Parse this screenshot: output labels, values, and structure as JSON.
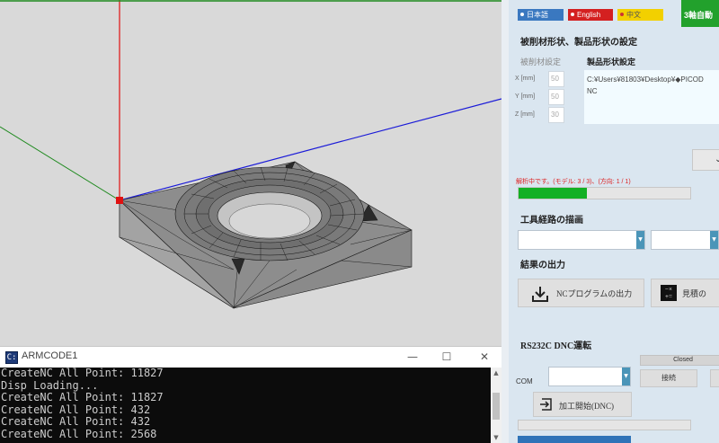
{
  "console": {
    "title": "ARMCODE1",
    "minimize": "—",
    "maximize": "☐",
    "close": "✕",
    "lines": [
      "CreateNC All Point: 11827",
      "Disp Loading...",
      "CreateNC All Point: 11827",
      "CreateNC All Point: 432",
      "CreateNC All Point: 432",
      "CreateNC All Point: 2568"
    ]
  },
  "languages": [
    {
      "label": "日本語",
      "color": "#3a78c0"
    },
    {
      "label": "English",
      "color": "#d42020"
    },
    {
      "label": "中文",
      "color": "#f2d000"
    }
  ],
  "auto_button": "3軸自動",
  "settings": {
    "section_title": "被削材形状、製品形状の設定",
    "workpiece_label": "被削材設定",
    "product_label": "製品形状設定",
    "x_label": "X [mm]",
    "y_label": "Y [mm]",
    "z_label": "Z [mm]",
    "x_value": "50",
    "y_value": "50",
    "z_value": "30",
    "product_path": "C:¥Users¥81803¥Desktop¥◆PICOD",
    "product_path_2": "NC"
  },
  "status": {
    "text": "解析中です。(モデル: 3 / 3)、(方向: 1 / 1)",
    "progress_fraction": 0.4
  },
  "toolpath": {
    "section_title": "工具経路の描画"
  },
  "output": {
    "section_title": "結果の出力",
    "nc_button": "NCプログラムの出力",
    "estimate_button": "見積の"
  },
  "dnc": {
    "section_title": "RS232C DNC運転",
    "closed_label": "Closed",
    "com_label": "COM",
    "connect_button": "接続",
    "start_button": "加工開始(DNC)"
  },
  "colors": {
    "x_axis": "#1f8a1f",
    "y_axis": "#e01010",
    "z_axis": "#1a1ad8",
    "model_fill": "#8f8f8f",
    "model_edge": "#1a1a1a"
  }
}
